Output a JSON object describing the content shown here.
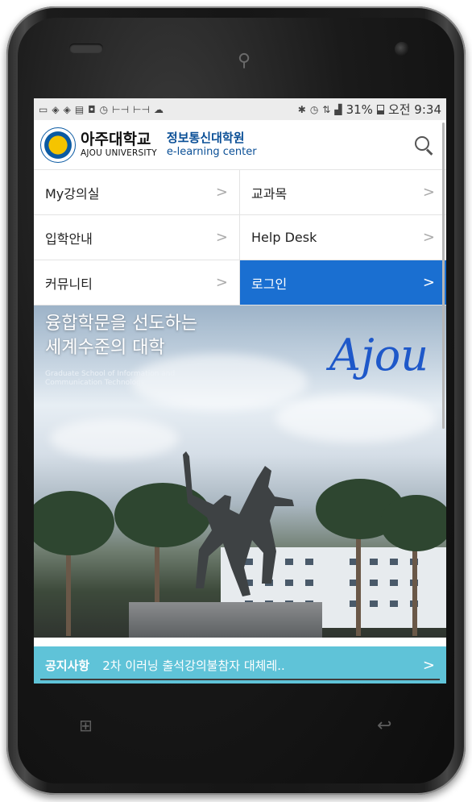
{
  "status_bar": {
    "battery": "31%",
    "time": "오전 9:34",
    "icons": [
      "message-icon",
      "delivery-icon",
      "delivery-icon",
      "keyboard-icon",
      "shield-icon",
      "alarm-icon",
      "signal-icon",
      "signal-icon",
      "weather-icon",
      "bluetooth-icon",
      "alarm-icon",
      "lte-icon",
      "cell-signal-icon",
      "battery-icon"
    ]
  },
  "header": {
    "brand_ko": "아주대학교",
    "brand_en": "AJOU UNIVERSITY",
    "sub_ko": "정보통신대학원",
    "sub_en": "e-learning center",
    "search_icon": "search-icon"
  },
  "menu": [
    {
      "label": "My강의실",
      "active": false
    },
    {
      "label": "교과목",
      "active": false
    },
    {
      "label": "입학안내",
      "active": false
    },
    {
      "label": "Help Desk",
      "active": false
    },
    {
      "label": "커뮤니티",
      "active": false
    },
    {
      "label": "로그인",
      "active": true
    }
  ],
  "hero": {
    "title_line1": "융합학문을 선도하는",
    "title_line2": "세계수준의 대학",
    "subtitle": "Graduate School of Information and Communication Technology",
    "signature": "Ajou"
  },
  "notice": {
    "label": "공지사항",
    "text": "2차 이러닝 출석강의불참자 대체레..",
    "chevron": ">"
  },
  "colors": {
    "active_menu": "#1a6fd1",
    "notice_bar": "#5fc3d8",
    "brand_blue": "#0a4f96"
  }
}
